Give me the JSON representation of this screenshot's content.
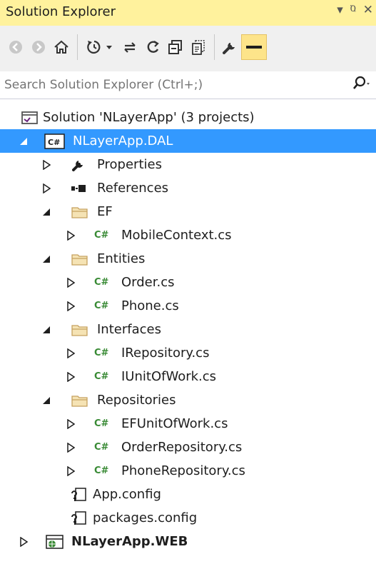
{
  "header": {
    "title": "Solution Explorer",
    "menu_glyph": "▾",
    "pin_glyph": "ⱒ",
    "close_glyph": "✕"
  },
  "search": {
    "placeholder": "Search Solution Explorer (Ctrl+;)"
  },
  "colors": {
    "title_bar": "#fff29d",
    "selection": "#3399ff",
    "folder": "#dcb67a",
    "csharp": "#388a34"
  },
  "tree": {
    "solution": "Solution 'NLayerApp' (3 projects)",
    "dal": "NLayerApp.DAL",
    "properties": "Properties",
    "references": "References",
    "ef": "EF",
    "mobile_context": "MobileContext.cs",
    "entities": "Entities",
    "order": "Order.cs",
    "phone": "Phone.cs",
    "interfaces": "Interfaces",
    "irepository": "IRepository.cs",
    "iunitofwork": "IUnitOfWork.cs",
    "repositories": "Repositories",
    "efunitofwork": "EFUnitOfWork.cs",
    "orderrepository": "OrderRepository.cs",
    "phonerepository": "PhoneRepository.cs",
    "app_config": "App.config",
    "packages_config": "packages.config",
    "web": "NLayerApp.WEB",
    "csharp_badge": "C#"
  }
}
